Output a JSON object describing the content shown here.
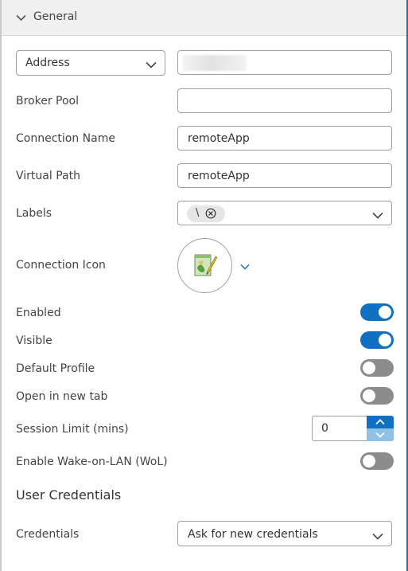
{
  "header": {
    "title": "General"
  },
  "address": {
    "type_label": "Address",
    "value": ""
  },
  "broker_pool": {
    "label": "Broker Pool",
    "value": ""
  },
  "connection_name": {
    "label": "Connection Name",
    "value": "remoteApp"
  },
  "virtual_path": {
    "label": "Virtual Path",
    "value": "remoteApp"
  },
  "labels": {
    "label": "Labels",
    "chips": [
      "\\"
    ]
  },
  "connection_icon": {
    "label": "Connection Icon",
    "icon": "notepad-paint-app-icon"
  },
  "toggles": {
    "enabled": {
      "label": "Enabled",
      "on": true
    },
    "visible": {
      "label": "Visible",
      "on": true
    },
    "default_profile": {
      "label": "Default Profile",
      "on": false
    },
    "open_new_tab": {
      "label": "Open in new tab",
      "on": false
    },
    "wake_on_lan": {
      "label": "Enable Wake-on-LAN (WoL)",
      "on": false
    }
  },
  "session_limit": {
    "label": "Session Limit (mins)",
    "value": "0"
  },
  "user_credentials": {
    "section_title": "User Credentials",
    "credentials_label": "Credentials",
    "credentials_value": "Ask for new credentials"
  },
  "colors": {
    "accent": "#1170bf",
    "toggle_off": "#8c8c8c",
    "header_bg": "#f0f0f0"
  }
}
